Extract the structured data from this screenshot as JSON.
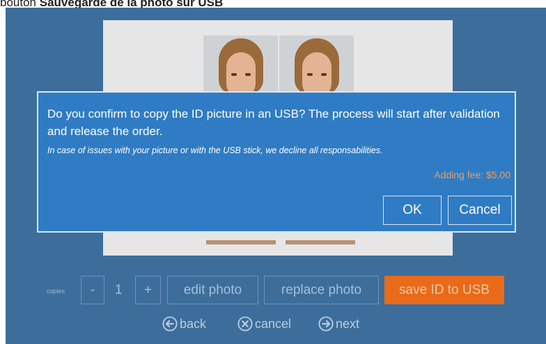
{
  "caption": {
    "prefix": "bouton ",
    "bold": "Sauvegarde de la photo sur USB"
  },
  "dialog": {
    "question": "Do you confirm to copy the ID picture in an USB? The process will start after validation and release the order.",
    "note": "In case of issues with your picture or with the USB stick, we decline all responsabilities.",
    "fee": "Adding fee: $5.00",
    "ok_label": "OK",
    "cancel_label": "Cancel"
  },
  "toolbar": {
    "copies_label": "copies",
    "minus_label": "-",
    "copies_value": "1",
    "plus_label": "+",
    "edit_label": "edit photo",
    "replace_label": "replace photo",
    "save_label": "save ID to USB"
  },
  "nav": {
    "back": "back",
    "cancel": "cancel",
    "next": "next"
  },
  "colors": {
    "background": "#3d6e9b",
    "dialog": "#2f7cc4",
    "accent": "#e96a19",
    "fee": "#f29a5a"
  },
  "icons": [
    "arrow-left-circle-icon",
    "close-circle-icon",
    "arrow-right-circle-icon"
  ]
}
